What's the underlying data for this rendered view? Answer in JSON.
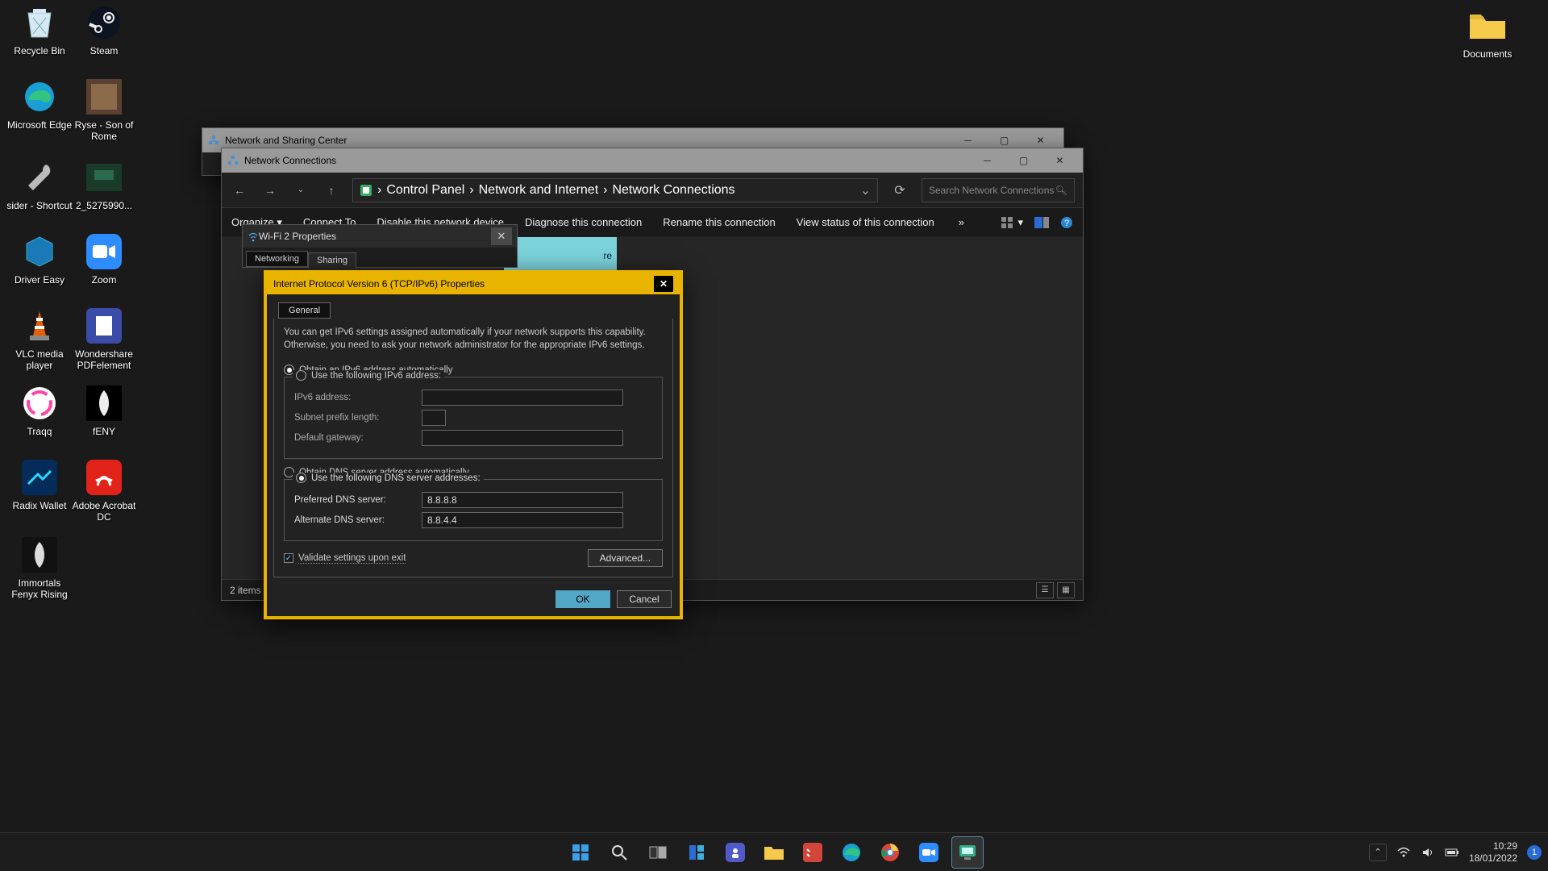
{
  "desktop": {
    "icons": [
      {
        "label": "Recycle Bin"
      },
      {
        "label": "Steam"
      },
      {
        "label": "Microsoft Edge"
      },
      {
        "label": "Ryse - Son of Rome"
      },
      {
        "label": "sider - Shortcut"
      },
      {
        "label": "2_5275990..."
      },
      {
        "label": "Driver Easy"
      },
      {
        "label": "Zoom"
      },
      {
        "label": "VLC media player"
      },
      {
        "label": "Wondershare PDFelement"
      },
      {
        "label": "Traqq"
      },
      {
        "label": "fENY"
      },
      {
        "label": "Radix Wallet"
      },
      {
        "label": "Adobe Acrobat DC"
      },
      {
        "label": "Immortals Fenyx Rising"
      }
    ],
    "documents_label": "Documents"
  },
  "win_sharing": {
    "title": "Network and Sharing Center"
  },
  "win_nc": {
    "title": "Network Connections",
    "breadcrumb": [
      "Control Panel",
      "Network and Internet",
      "Network Connections"
    ],
    "search_placeholder": "Search Network Connections",
    "cmdbar": {
      "organize": "Organize",
      "connect": "Connect To",
      "disable": "Disable this network device",
      "diagnose": "Diagnose this connection",
      "rename": "Rename this connection",
      "viewstatus": "View status of this connection"
    },
    "status": "2 items",
    "sel_label": "re"
  },
  "wifi": {
    "title": "Wi-Fi 2 Properties",
    "tabs": {
      "networking": "Networking",
      "sharing": "Sharing"
    }
  },
  "ipv6": {
    "title": "Internet Protocol Version 6 (TCP/IPv6) Properties",
    "tab_general": "General",
    "info": "You can get IPv6 settings assigned automatically if your network supports this capability. Otherwise, you need to ask your network administrator for the appropriate IPv6 settings.",
    "obtain_ip_auto": "Obtain an IPv6 address automatically",
    "use_ip": "Use the following IPv6 address:",
    "ip_addr_label": "IPv6 address:",
    "prefix_label": "Subnet prefix length:",
    "gateway_label": "Default gateway:",
    "obtain_dns_auto": "Obtain DNS server address automatically",
    "use_dns": "Use the following DNS server addresses:",
    "pref_dns_label": "Preferred DNS server:",
    "alt_dns_label": "Alternate DNS server:",
    "pref_dns_value": "8.8.8.8",
    "alt_dns_value": "8.8.4.4",
    "validate": "Validate settings upon exit",
    "advanced": "Advanced...",
    "ok": "OK",
    "cancel": "Cancel"
  },
  "taskbar": {
    "time": "10:29",
    "date": "18/01/2022",
    "notif_count": "1"
  }
}
